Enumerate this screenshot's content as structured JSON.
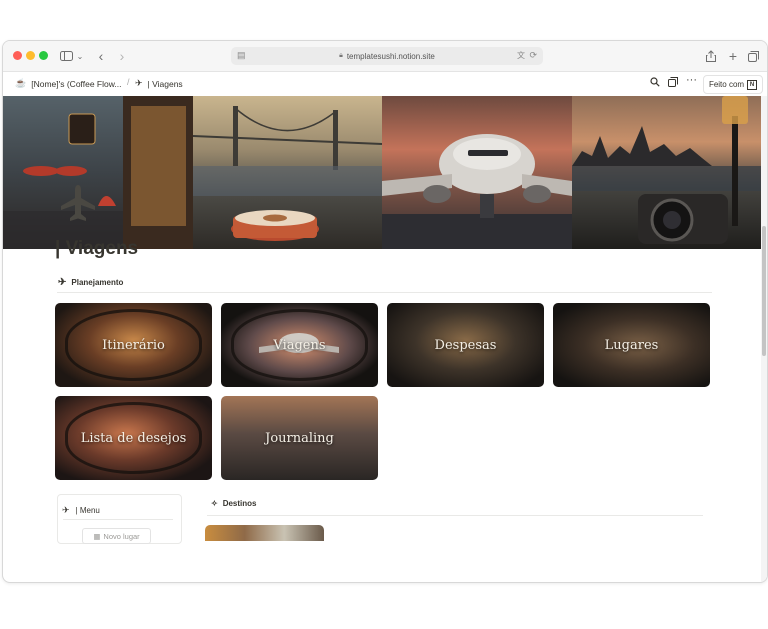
{
  "browser": {
    "url": "templatesushi.notion.site",
    "icons": [
      "sidebar-icon",
      "chevron-down-icon",
      "back-icon",
      "forward-icon",
      "translate-icon",
      "reload-icon",
      "share-icon",
      "new-tab-icon",
      "tabs-overview-icon"
    ]
  },
  "notion_bar": {
    "workspace_crumb": "[Nome]'s (Coffee Flow...",
    "separator": "/",
    "page_crumb": "| Viagens",
    "made_with": "Feito com"
  },
  "page": {
    "title": "| Viagens",
    "icon": "airplane-icon",
    "section": "Planejamento"
  },
  "gallery": [
    {
      "label": "Itinerário"
    },
    {
      "label": "Viagens"
    },
    {
      "label": "Despesas"
    },
    {
      "label": "Lugares"
    },
    {
      "label": "Lista de desejos"
    },
    {
      "label": "Journaling"
    }
  ],
  "menu": {
    "title": "| Menu",
    "new_place": "Novo lugar"
  },
  "destinos": {
    "title": "Destinos"
  },
  "colors": {
    "text": "#37352f",
    "divider": "#e9e9e7"
  }
}
